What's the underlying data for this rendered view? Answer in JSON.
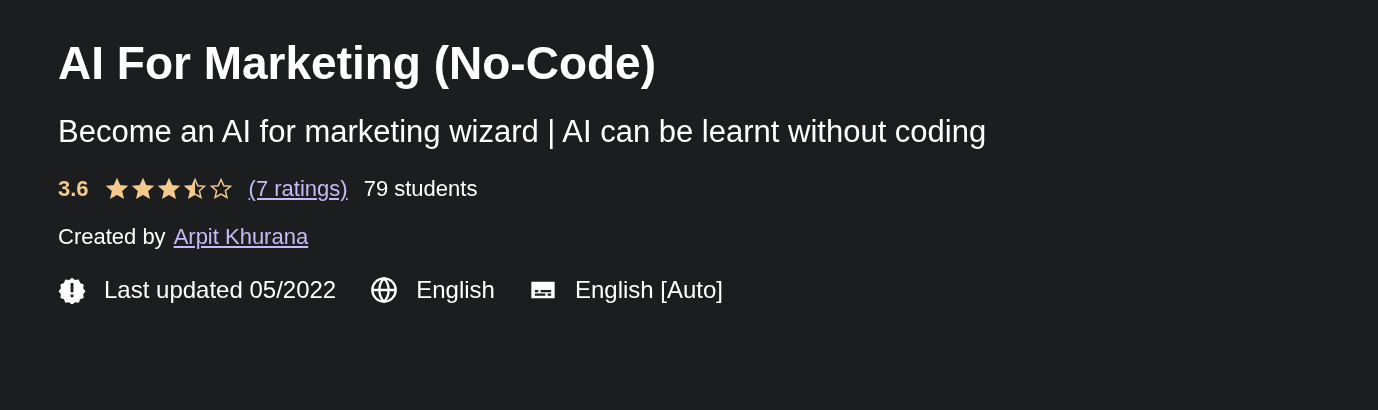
{
  "course": {
    "title": "AI For Marketing (No-Code)",
    "subtitle": "Become an AI for marketing wizard | AI can be learnt without coding"
  },
  "rating": {
    "score": "3.6",
    "stars": 3.5,
    "ratings_link": "(7 ratings)",
    "students": "79 students"
  },
  "creator": {
    "label": "Created by",
    "name": "Arpit Khurana"
  },
  "meta": [
    {
      "kind": "updated",
      "text": "Last updated 05/2022"
    },
    {
      "kind": "language",
      "text": "English"
    },
    {
      "kind": "captions",
      "text": "English [Auto]"
    }
  ]
}
